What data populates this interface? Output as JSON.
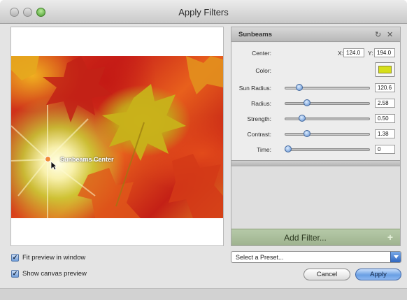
{
  "window": {
    "title": "Apply Filters"
  },
  "filter_panel": {
    "title": "Sunbeams",
    "params": {
      "center": {
        "label": "Center:",
        "x_label": "X:",
        "x": "124.0",
        "y_label": "Y:",
        "y": "194.0"
      },
      "color": {
        "label": "Color:",
        "value": "#d6df1a"
      },
      "sun_radius": {
        "label": "Sun Radius:",
        "value": "120.6",
        "level": 0.14
      },
      "radius": {
        "label": "Radius:",
        "value": "2.58",
        "level": 0.24
      },
      "strength": {
        "label": "Strength:",
        "value": "0.50",
        "level": 0.18
      },
      "contrast": {
        "label": "Contrast:",
        "value": "1.38",
        "level": 0.24
      },
      "time": {
        "label": "Time:",
        "value": "0",
        "level": 0.0
      }
    },
    "add_filter_label": "Add Filter...",
    "add_icon": "plus-icon"
  },
  "preview": {
    "overlay_label": "Sunbeams Center"
  },
  "options": {
    "fit_preview": {
      "label": "Fit preview in window",
      "checked": true
    },
    "show_canvas": {
      "label": "Show canvas preview",
      "checked": true
    }
  },
  "preset": {
    "placeholder": "Select a Preset..."
  },
  "buttons": {
    "cancel": "Cancel",
    "apply": "Apply"
  }
}
